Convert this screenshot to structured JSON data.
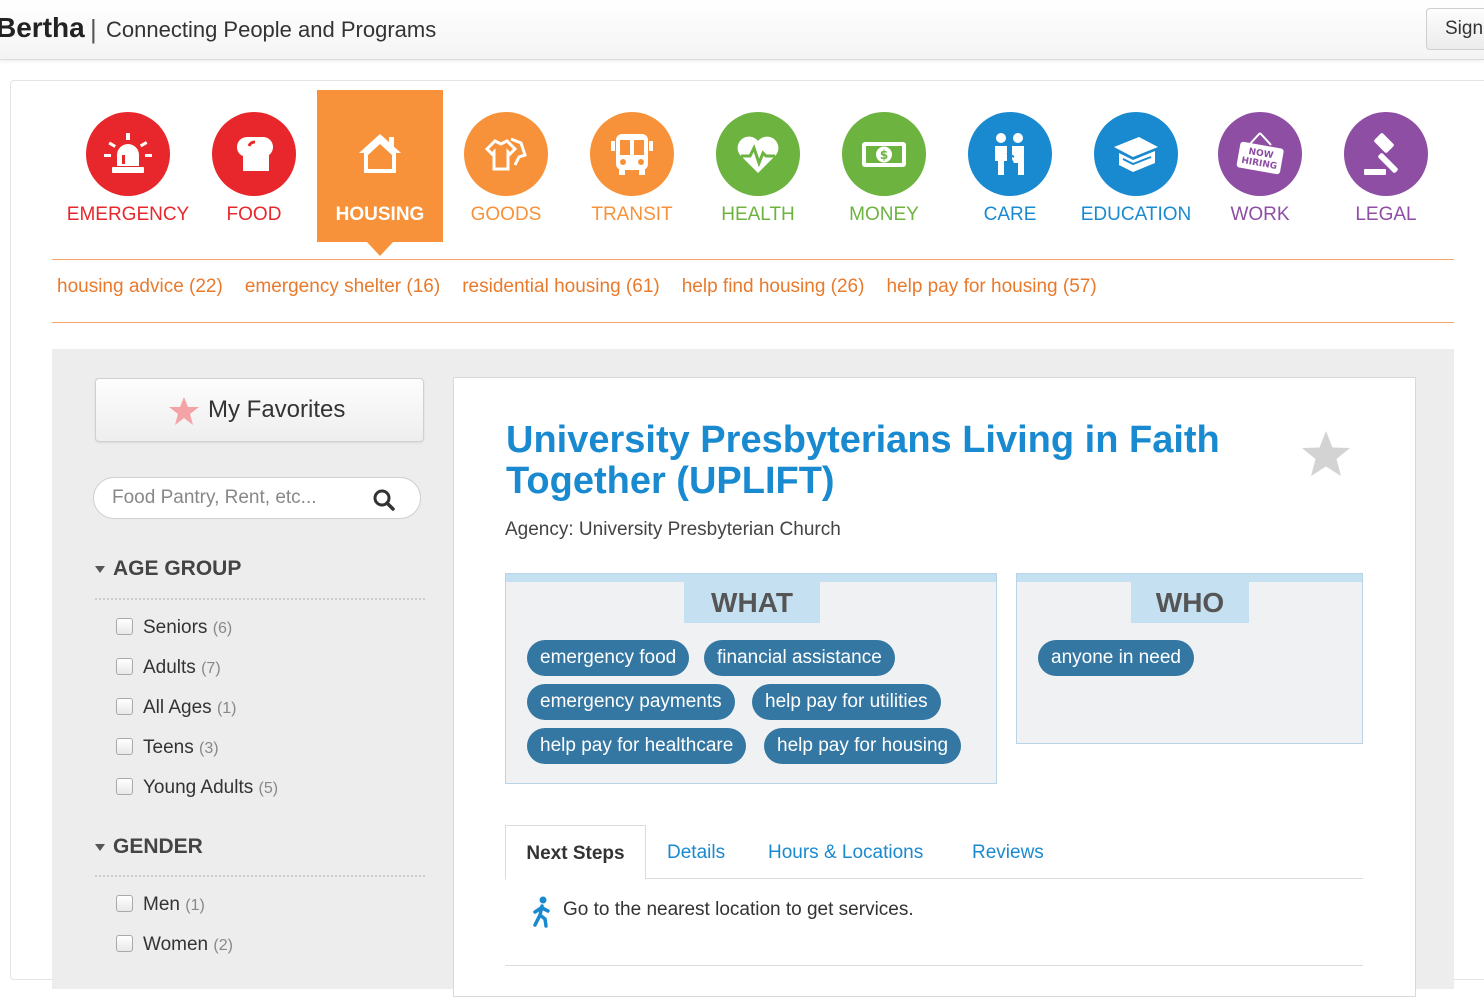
{
  "header": {
    "brand": "Bertha",
    "separator": "|",
    "tagline": "Connecting People and Programs",
    "signin_label": "Sign"
  },
  "categories": [
    {
      "label": "EMERGENCY",
      "color": "#e8272c",
      "icon": "siren-icon"
    },
    {
      "label": "FOOD",
      "color": "#e8272c",
      "icon": "bread-icon"
    },
    {
      "label": "HOUSING",
      "color": "#f7923a",
      "icon": "house-icon",
      "active": true
    },
    {
      "label": "GOODS",
      "color": "#f7923a",
      "icon": "clothes-icon"
    },
    {
      "label": "TRANSIT",
      "color": "#f7923a",
      "icon": "bus-icon"
    },
    {
      "label": "HEALTH",
      "color": "#6cb33f",
      "icon": "heart-pulse-icon"
    },
    {
      "label": "MONEY",
      "color": "#6cb33f",
      "icon": "money-icon"
    },
    {
      "label": "CARE",
      "color": "#1a8ad0",
      "icon": "people-icon"
    },
    {
      "label": "EDUCATION",
      "color": "#1a8ad0",
      "icon": "book-icon"
    },
    {
      "label": "WORK",
      "color": "#8d4ea4",
      "icon": "now-hiring-icon",
      "sign_line1": "NOW",
      "sign_line2": "HIRING"
    },
    {
      "label": "LEGAL",
      "color": "#8d4ea4",
      "icon": "gavel-icon"
    }
  ],
  "subcategories": [
    "housing advice (22)",
    "emergency shelter (16)",
    "residential housing (61)",
    "help find housing (26)",
    "help pay for housing (57)"
  ],
  "sidebar": {
    "favorites_label": "My Favorites",
    "search_placeholder": "Food Pantry, Rent, etc...",
    "facets": [
      {
        "heading": "AGE GROUP",
        "options": [
          {
            "label": "Seniors",
            "count": "(6)"
          },
          {
            "label": "Adults",
            "count": "(7)"
          },
          {
            "label": "All Ages",
            "count": "(1)"
          },
          {
            "label": "Teens",
            "count": "(3)"
          },
          {
            "label": "Young Adults",
            "count": "(5)"
          }
        ]
      },
      {
        "heading": "GENDER",
        "options": [
          {
            "label": "Men",
            "count": "(1)"
          },
          {
            "label": "Women",
            "count": "(2)"
          }
        ]
      }
    ]
  },
  "program": {
    "title": "University Presbyterians Living in Faith Together (UPLIFT)",
    "agency": "Agency: University Presbyterian Church",
    "what_heading": "WHAT",
    "what_tags": [
      "emergency food",
      "financial assistance",
      "emergency payments",
      "help pay for utilities",
      "help pay for healthcare",
      "help pay for housing"
    ],
    "who_heading": "WHO",
    "who_tags": [
      "anyone in need"
    ],
    "tabs": [
      "Next Steps",
      "Details",
      "Hours & Locations",
      "Reviews"
    ],
    "next_step": "Go to the nearest location to get services."
  }
}
